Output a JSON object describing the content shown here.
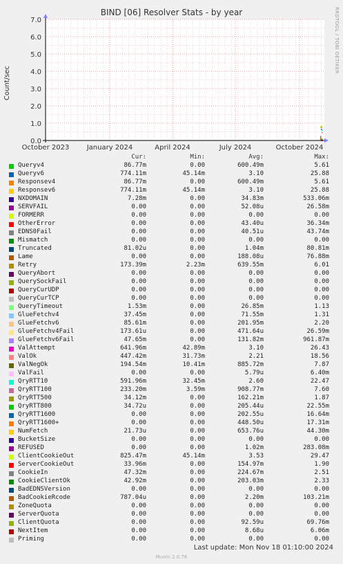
{
  "chart_data": {
    "type": "line",
    "title": "BIND [06] Resolver Stats - by year",
    "ylabel": "Count/sec",
    "side_label": "RRDTOOL / TOBI OETIKER",
    "ylim": [
      0,
      7
    ],
    "yticks": [
      "0.0",
      "1.0",
      "2.0",
      "3.0",
      "4.0",
      "5.0",
      "6.0",
      "7.0"
    ],
    "xticks": [
      "October 2023",
      "January 2024",
      "April 2024",
      "July 2024",
      "October 2024"
    ],
    "grid": true,
    "columns": [
      "Cur:",
      "Min:",
      "Avg:",
      "Max:"
    ],
    "series": [
      {
        "name": "Queryv4",
        "color": "#00cc00",
        "cur": "86.77m",
        "min": "0.00",
        "avg": "600.49m",
        "max": "5.61"
      },
      {
        "name": "Queryv6",
        "color": "#0066b3",
        "cur": "774.11m",
        "min": "45.14m",
        "avg": "3.10",
        "max": "25.88"
      },
      {
        "name": "Responsev4",
        "color": "#ff8000",
        "cur": "86.77m",
        "min": "0.00",
        "avg": "600.49m",
        "max": "5.61"
      },
      {
        "name": "Responsev6",
        "color": "#ffcc00",
        "cur": "774.11m",
        "min": "45.14m",
        "avg": "3.10",
        "max": "25.88"
      },
      {
        "name": "NXDOMAIN",
        "color": "#330099",
        "cur": "7.28m",
        "min": "0.00",
        "avg": "34.83m",
        "max": "533.06m"
      },
      {
        "name": "SERVFAIL",
        "color": "#990099",
        "cur": "0.00",
        "min": "0.00",
        "avg": "52.08u",
        "max": "26.58m"
      },
      {
        "name": "FORMERR",
        "color": "#ccff00",
        "cur": "0.00",
        "min": "0.00",
        "avg": "0.00",
        "max": "0.00"
      },
      {
        "name": "OtherError",
        "color": "#ff0000",
        "cur": "0.00",
        "min": "0.00",
        "avg": "43.40u",
        "max": "36.34m"
      },
      {
        "name": "EDNS0Fail",
        "color": "#808080",
        "cur": "0.00",
        "min": "0.00",
        "avg": "40.51u",
        "max": "43.74m"
      },
      {
        "name": "Mismatch",
        "color": "#008f00",
        "cur": "0.00",
        "min": "0.00",
        "avg": "0.00",
        "max": "0.00"
      },
      {
        "name": "Truncated",
        "color": "#00487d",
        "cur": "81.02u",
        "min": "0.00",
        "avg": "1.04m",
        "max": "80.81m"
      },
      {
        "name": "Lame",
        "color": "#b35a00",
        "cur": "0.00",
        "min": "0.00",
        "avg": "188.08u",
        "max": "76.88m"
      },
      {
        "name": "Retry",
        "color": "#b38f00",
        "cur": "173.39m",
        "min": "2.23m",
        "avg": "639.55m",
        "max": "6.01"
      },
      {
        "name": "QueryAbort",
        "color": "#6b006b",
        "cur": "0.00",
        "min": "0.00",
        "avg": "0.00",
        "max": "0.00"
      },
      {
        "name": "QuerySockFail",
        "color": "#8fb300",
        "cur": "0.00",
        "min": "0.00",
        "avg": "0.00",
        "max": "0.00"
      },
      {
        "name": "QueryCurUDP",
        "color": "#b30000",
        "cur": "0.00",
        "min": "0.00",
        "avg": "0.00",
        "max": "0.00"
      },
      {
        "name": "QueryCurTCP",
        "color": "#bebebe",
        "cur": "0.00",
        "min": "0.00",
        "avg": "0.00",
        "max": "0.00"
      },
      {
        "name": "QueryTimeout",
        "color": "#80ff80",
        "cur": "1.53m",
        "min": "0.00",
        "avg": "26.85m",
        "max": "1.13"
      },
      {
        "name": "GlueFetchv4",
        "color": "#80c9ff",
        "cur": "37.45m",
        "min": "0.00",
        "avg": "71.55m",
        "max": "1.31"
      },
      {
        "name": "GlueFetchv6",
        "color": "#ffc080",
        "cur": "85.61m",
        "min": "0.00",
        "avg": "201.95m",
        "max": "2.20"
      },
      {
        "name": "GlueFetchv4Fail",
        "color": "#ffe680",
        "cur": "173.61u",
        "min": "0.00",
        "avg": "471.64u",
        "max": "26.59m"
      },
      {
        "name": "GlueFetchv6Fail",
        "color": "#aa80ff",
        "cur": "47.65m",
        "min": "0.00",
        "avg": "131.82m",
        "max": "961.87m"
      },
      {
        "name": "ValAttempt",
        "color": "#ee00cc",
        "cur": "641.96m",
        "min": "42.89m",
        "avg": "3.10",
        "max": "26.43"
      },
      {
        "name": "ValOk",
        "color": "#ff8080",
        "cur": "447.42m",
        "min": "31.73m",
        "avg": "2.21",
        "max": "18.56"
      },
      {
        "name": "ValNegOk",
        "color": "#666600",
        "cur": "194.54m",
        "min": "10.41m",
        "avg": "885.72m",
        "max": "7.87"
      },
      {
        "name": "ValFail",
        "color": "#ffbfff",
        "cur": "0.00",
        "min": "0.00",
        "avg": "5.79u",
        "max": "6.40m"
      },
      {
        "name": "QryRTT10",
        "color": "#00ffcc",
        "cur": "591.96m",
        "min": "32.45m",
        "avg": "2.60",
        "max": "22.47"
      },
      {
        "name": "QryRTT100",
        "color": "#cc6699",
        "cur": "233.20m",
        "min": "3.59m",
        "avg": "908.77m",
        "max": "7.60"
      },
      {
        "name": "QryRTT500",
        "color": "#999900",
        "cur": "34.12m",
        "min": "0.00",
        "avg": "162.21m",
        "max": "1.87"
      },
      {
        "name": "QryRTT800",
        "color": "#00cc00",
        "cur": "34.72u",
        "min": "0.00",
        "avg": "205.44u",
        "max": "22.55m"
      },
      {
        "name": "QryRTT1600",
        "color": "#0066b3",
        "cur": "0.00",
        "min": "0.00",
        "avg": "202.55u",
        "max": "16.64m"
      },
      {
        "name": "QryRTT1600+",
        "color": "#ff8000",
        "cur": "0.00",
        "min": "0.00",
        "avg": "448.50u",
        "max": "17.31m"
      },
      {
        "name": "NumFetch",
        "color": "#ffcc00",
        "cur": "21.73u",
        "min": "0.00",
        "avg": "653.76u",
        "max": "44.30m"
      },
      {
        "name": "BucketSize",
        "color": "#330099",
        "cur": "0.00",
        "min": "0.00",
        "avg": "0.00",
        "max": "0.00"
      },
      {
        "name": "REFUSED",
        "color": "#990099",
        "cur": "0.00",
        "min": "0.00",
        "avg": "1.02m",
        "max": "283.08m"
      },
      {
        "name": "ClientCookieOut",
        "color": "#ccff00",
        "cur": "825.47m",
        "min": "45.14m",
        "avg": "3.53",
        "max": "29.47"
      },
      {
        "name": "ServerCookieOut",
        "color": "#ff0000",
        "cur": "33.96m",
        "min": "0.00",
        "avg": "154.97m",
        "max": "1.90"
      },
      {
        "name": "CookieIn",
        "color": "#808080",
        "cur": "47.32m",
        "min": "0.00",
        "avg": "224.67m",
        "max": "2.51"
      },
      {
        "name": "CookieClientOk",
        "color": "#008f00",
        "cur": "42.92m",
        "min": "0.00",
        "avg": "203.03m",
        "max": "2.33"
      },
      {
        "name": "BadEDNSVersion",
        "color": "#00487d",
        "cur": "0.00",
        "min": "0.00",
        "avg": "0.00",
        "max": "0.00"
      },
      {
        "name": "BadCookieRcode",
        "color": "#b35a00",
        "cur": "787.04u",
        "min": "0.00",
        "avg": "2.20m",
        "max": "103.21m"
      },
      {
        "name": "ZoneQuota",
        "color": "#b38f00",
        "cur": "0.00",
        "min": "0.00",
        "avg": "0.00",
        "max": "0.00"
      },
      {
        "name": "ServerQuota",
        "color": "#6b006b",
        "cur": "0.00",
        "min": "0.00",
        "avg": "0.00",
        "max": "0.00"
      },
      {
        "name": "ClientQuota",
        "color": "#8fb300",
        "cur": "0.00",
        "min": "0.00",
        "avg": "92.59u",
        "max": "69.76m"
      },
      {
        "name": "NextItem",
        "color": "#b30000",
        "cur": "0.00",
        "min": "0.00",
        "avg": "8.68u",
        "max": "6.06m"
      },
      {
        "name": "Priming",
        "color": "#bebebe",
        "cur": "0.00",
        "min": "0.00",
        "avg": "0.00",
        "max": "0.00"
      }
    ]
  },
  "footer": {
    "last_update": "Last update: Mon Nov 18 01:10:00 2024",
    "generator": "Munin 2.0.76"
  }
}
